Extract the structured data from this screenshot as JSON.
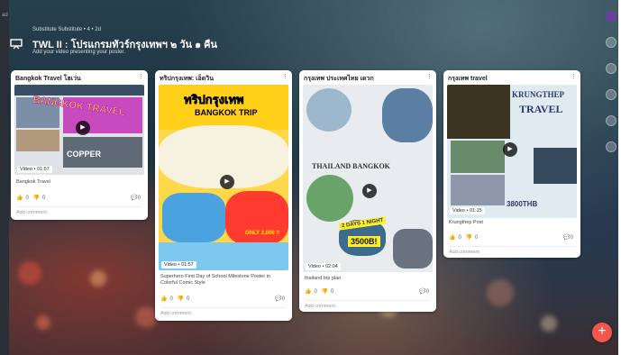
{
  "wall": {
    "breadcrumb": "Substitute Substitute • 4 • 2d",
    "title": "TWL II : โปรแกรมทัวร์กรุงเทพฯ ๒ วัน ๑ คืน",
    "subtitle": "Add your video presenting your poster.",
    "corner": "ad"
  },
  "cards": [
    {
      "author": "Bangkok Travel โฮเว่น",
      "badge": "Video • 01:57",
      "caption": "Bangkok Travel",
      "likes": "0",
      "dislikes": "0",
      "comments": "0",
      "add_comment": "Add comment",
      "thumb_text": [
        "BANGKOK TRAVEL",
        "COPPER"
      ]
    },
    {
      "author": "ทริปกรุงเทพ: เอ็ดวิน",
      "badge": "Video • 01:57",
      "caption": "Superhero First Day of School Milestone Poster in Colorful Comic Style",
      "likes": "0",
      "dislikes": "0",
      "comments": "0",
      "add_comment": "Add comment",
      "thumb_text": [
        "ทริปกรุงเทพ",
        "BANGKOK TRIP",
        "ONLY 2,000 !!"
      ]
    },
    {
      "author": "กรุงเทพ ประเทศไทย เดวก",
      "badge": "Video • 02:04",
      "caption": "thailand trip plan",
      "likes": "0",
      "dislikes": "0",
      "comments": "0",
      "add_comment": "Add comment",
      "thumb_text": [
        "THAILAND BANGKOK",
        "2 DAYS 1 NIGHT",
        "3500B!"
      ]
    },
    {
      "author": "กรุงเทพ travel",
      "badge": "Video • 01:15",
      "caption": "Krungthep Post",
      "likes": "0",
      "dislikes": "0",
      "comments": "0",
      "add_comment": "Add comment",
      "thumb_text": [
        "KRUNGTHEP",
        "TRAVEL",
        "3800THB"
      ]
    }
  ],
  "fab": {
    "label": "+"
  },
  "icons": {
    "wall": "presentation-icon",
    "like": "thumb-up-icon",
    "dislike": "thumb-down-icon",
    "comment": "comment-icon",
    "menu": "more-vertical-icon",
    "play": "play-icon"
  },
  "colors": {
    "fab": "#f2564f",
    "background": "#1d3340"
  }
}
